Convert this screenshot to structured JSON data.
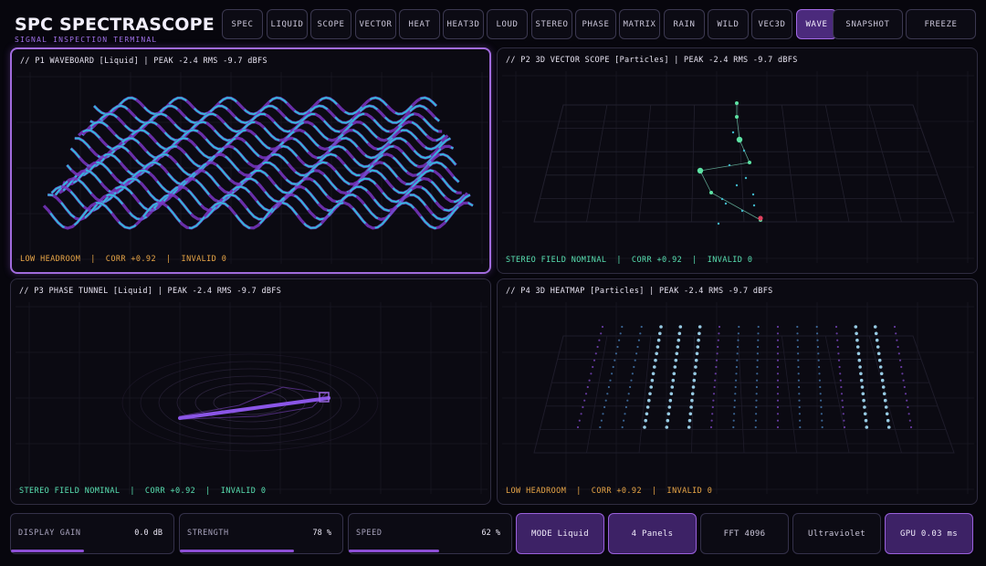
{
  "app": {
    "title": "SPC SPECTRASCOPE",
    "subtitle": "SIGNAL INSPECTION TERMINAL"
  },
  "tabs": [
    {
      "label": "SPEC"
    },
    {
      "label": "LIQUID"
    },
    {
      "label": "SCOPE"
    },
    {
      "label": "VECTOR"
    },
    {
      "label": "HEAT"
    },
    {
      "label": "HEAT3D"
    },
    {
      "label": "LOUD"
    },
    {
      "label": "STEREO"
    },
    {
      "label": "PHASE"
    },
    {
      "label": "MATRIX"
    },
    {
      "label": "RAIN"
    },
    {
      "label": "WILD"
    },
    {
      "label": "VEC3D"
    },
    {
      "label": "WAVE",
      "active": true
    }
  ],
  "actions": {
    "snapshot": "SNAPSHOT",
    "freeze": "FREEZE"
  },
  "panels": [
    {
      "title": "// P1 WAVEBOARD [Liquid] | PEAK -2.4 RMS -9.7 dBFS",
      "status": "LOW HEADROOM  |  CORR +0.92  |  INVALID 0",
      "tone": "amber"
    },
    {
      "title": "// P2 3D VECTOR SCOPE [Particles] | PEAK -2.4 RMS -9.7 dBFS",
      "status": "STEREO FIELD NOMINAL  |  CORR +0.92  |  INVALID 0",
      "tone": "teal"
    },
    {
      "title": "// P3 PHASE TUNNEL [Liquid] | PEAK -2.4 RMS -9.7 dBFS",
      "status": "STEREO FIELD NOMINAL  |  CORR +0.92  |  INVALID 0",
      "tone": "teal"
    },
    {
      "title": "// P4 3D HEATMAP [Particles] | PEAK -2.4 RMS -9.7 dBFS",
      "status": "LOW HEADROOM  |  CORR +0.92  |  INVALID 0",
      "tone": "amber"
    }
  ],
  "controls": {
    "gain": {
      "label": "DISPLAY GAIN",
      "value": "0.0 dB",
      "level": 0.5
    },
    "strength": {
      "label": "STRENGTH",
      "value": "78 %",
      "level": 0.78
    },
    "speed": {
      "label": "SPEED",
      "value": "62 %",
      "level": 0.62
    }
  },
  "footer": {
    "mode": "MODE Liquid",
    "panels": "4 Panels",
    "fft": "FFT 4096",
    "theme": "Ultraviolet",
    "gpu": "GPU 0.03 ms"
  },
  "colors": {
    "accent": "#a16bdd",
    "cyan": "#2ec8e0",
    "purple": "#8a3fd0",
    "amber": "#e9a646",
    "teal": "#58e0b1",
    "red": "#e0405e"
  }
}
